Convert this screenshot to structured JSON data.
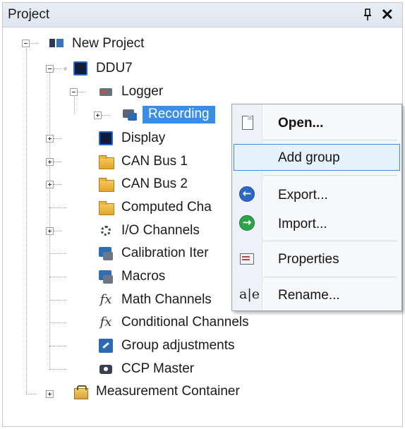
{
  "panel": {
    "title": "Project",
    "pin_glyph": "⬙",
    "close_glyph": "✕"
  },
  "tree": {
    "root": "New Project",
    "ddu": "DDU7",
    "logger": "Logger",
    "recording": "Recording",
    "display": "Display",
    "can1": "CAN Bus 1",
    "can2": "CAN Bus 2",
    "computed": "Computed Cha",
    "io": "I/O Channels",
    "calibration": "Calibration Iter",
    "macros": "Macros",
    "math": "Math Channels",
    "conditional": "Conditional Channels",
    "group_adj": "Group adjustments",
    "ccp": "CCP Master",
    "measurement": "Measurement Container",
    "fx_glyph": "fx"
  },
  "context_menu": {
    "open": "Open...",
    "add_group": "Add group",
    "export": "Export...",
    "import": "Import...",
    "properties": "Properties",
    "rename": "Rename...",
    "export_glyph": "←",
    "import_glyph": "→",
    "rename_glyph": "a|e"
  },
  "colors": {
    "selection": "#3a8ee6",
    "menu_hover_border": "#3c8de0",
    "menu_hover_fill": "#e5f1fb"
  }
}
